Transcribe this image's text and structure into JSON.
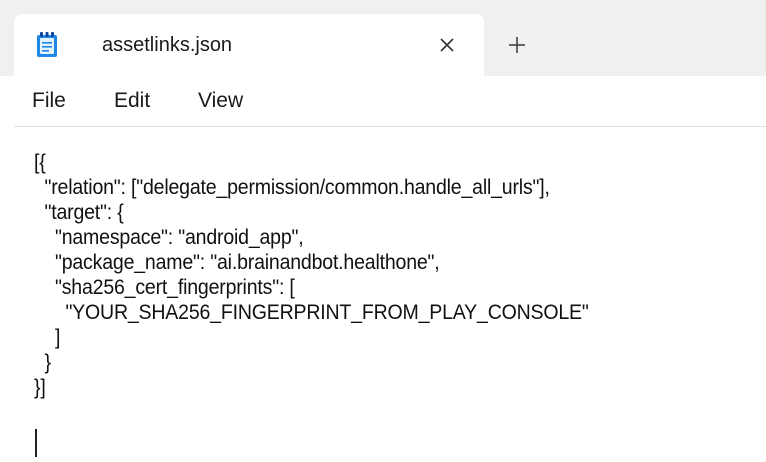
{
  "tab": {
    "title": "assetlinks.json",
    "icon": "notepad-file-icon",
    "close_icon": "close-icon",
    "new_tab_icon": "plus-icon"
  },
  "menu": {
    "file": "File",
    "edit": "Edit",
    "view": "View"
  },
  "editor": {
    "lines": [
      "[{",
      "  \"relation\": [\"delegate_permission/common.handle_all_urls\"],",
      "  \"target\": {",
      "    \"namespace\": \"android_app\",",
      "    \"package_name\": \"ai.brainandbot.healthone\",",
      "    \"sha256_cert_fingerprints\": [",
      "      \"YOUR_SHA256_FINGERPRINT_FROM_PLAY_CONSOLE\"",
      "    ]",
      "  }",
      "}]"
    ]
  },
  "colors": {
    "tabstrip": "#f0f0f0",
    "icon_blue": "#1e88e5",
    "text": "#111111"
  }
}
